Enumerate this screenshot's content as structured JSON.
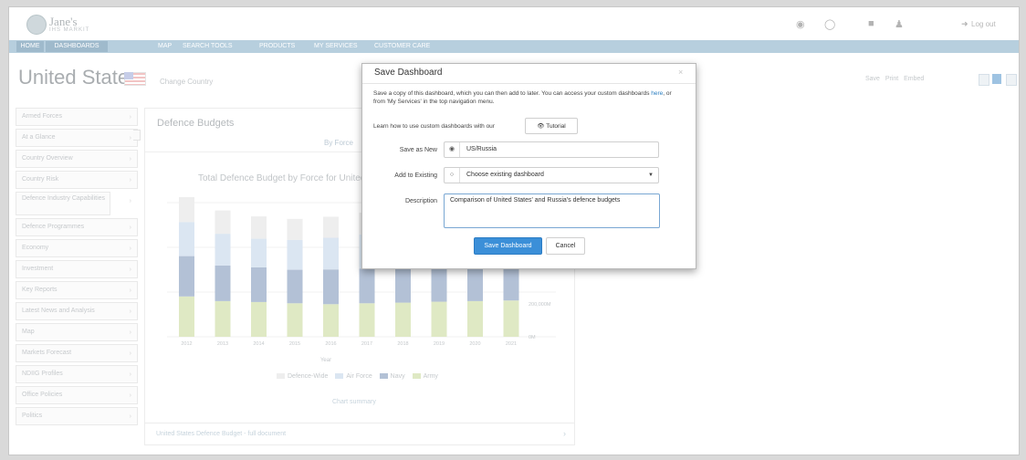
{
  "header": {
    "logo_text": "Jane's",
    "logo_sub": "IHS MARKIT",
    "logout": "Log out"
  },
  "nav": {
    "items": [
      "HOME",
      "DASHBOARDS",
      "MAP",
      "SEARCH TOOLS",
      "PRODUCTS",
      "MY SERVICES",
      "CUSTOMER CARE"
    ]
  },
  "page": {
    "country": "United States",
    "change_country": "Change Country",
    "tools": [
      "Save",
      "Print",
      "Embed"
    ]
  },
  "sidebar": {
    "items": [
      "Armed Forces",
      "At a Glance",
      "Country Overview",
      "Country Risk",
      "Defence Industry Capabilities",
      "Defence Programmes",
      "Economy",
      "Investment",
      "Key Reports",
      "Latest News and Analysis",
      "Map",
      "Markets Forecast",
      "NDIIG Profiles",
      "Office Policies",
      "Politics"
    ]
  },
  "panel": {
    "title": "Defence Budgets",
    "subtab": "By Force",
    "chart_title": "Total Defence Budget by Force for United States",
    "summary_link": "Chart summary",
    "footer_text": "United States Defence Budget - full document"
  },
  "chart_data": {
    "type": "bar",
    "title": "Total Defence Budget by Force for United States",
    "xlabel": "Year",
    "categories": [
      "2012",
      "2013",
      "2014",
      "2015",
      "2016",
      "2017",
      "2018",
      "2019",
      "2020",
      "2021"
    ],
    "y_tick_labels": [
      "0M",
      "200,000M"
    ],
    "series": [
      {
        "name": "Army",
        "color": "#dfe9c4",
        "values": [
          130,
          115,
          112,
          108,
          105,
          108,
          110,
          113,
          115,
          117
        ]
      },
      {
        "name": "Navy",
        "color": "#b3c1d6",
        "values": [
          130,
          115,
          112,
          108,
          112,
          112,
          113,
          114,
          118,
          120
        ]
      },
      {
        "name": "Air Force",
        "color": "#dbe6f2",
        "values": [
          110,
          102,
          92,
          96,
          102,
          110,
          112,
          112,
          110,
          112
        ]
      },
      {
        "name": "Defence-Wide",
        "color": "#eeeeee",
        "values": [
          80,
          75,
          72,
          68,
          68,
          70,
          72,
          74,
          75,
          76
        ]
      }
    ]
  },
  "modal": {
    "title": "Save Dashboard",
    "close": "×",
    "desc_1": "Save a copy of this dashboard, which you can then add to later. You can access your custom dashboards",
    "desc_link": "here",
    "desc_2": ", or from 'My Services' in the top navigation menu.",
    "learn_text": "Learn how to use custom dashboards with our",
    "tutorial_label": "Tutorial",
    "save_as_new_label": "Save as New",
    "save_as_new_value": "US/Russia",
    "add_existing_label": "Add to Existing",
    "add_existing_value": "Choose existing dashboard",
    "description_label": "Description",
    "description_value": "Comparison of United States' and Russia's defence budgets",
    "save_button": "Save Dashboard",
    "cancel_button": "Cancel"
  }
}
